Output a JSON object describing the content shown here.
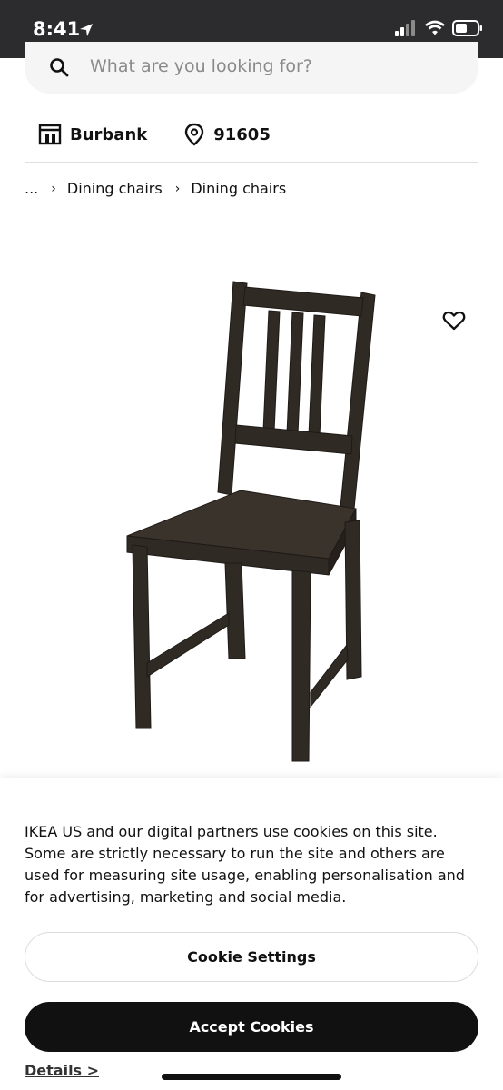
{
  "status_bar": {
    "time": "8:41"
  },
  "search": {
    "placeholder": "What are you looking for?"
  },
  "store": {
    "name": "Burbank",
    "zip": "91605"
  },
  "breadcrumb": {
    "ellipsis": "...",
    "items": [
      "Dining chairs",
      "Dining chairs"
    ]
  },
  "cookie_banner": {
    "message": "IKEA US and our digital partners use cookies on this site. Some are strictly necessary to run the site and others are used for measuring site usage, enabling personalisation and for advertising, marketing and social media.",
    "settings_label": "Cookie Settings",
    "accept_label": "Accept Cookies",
    "details_label": "Details >"
  },
  "colors": {
    "status_bg": "#2c2c2e",
    "accept_bg": "#111111",
    "chair": "#2f2a24"
  },
  "icons": [
    "location-arrow-icon",
    "signal-icon",
    "wifi-icon",
    "battery-icon",
    "search-icon",
    "store-icon",
    "pin-icon",
    "heart-icon"
  ]
}
